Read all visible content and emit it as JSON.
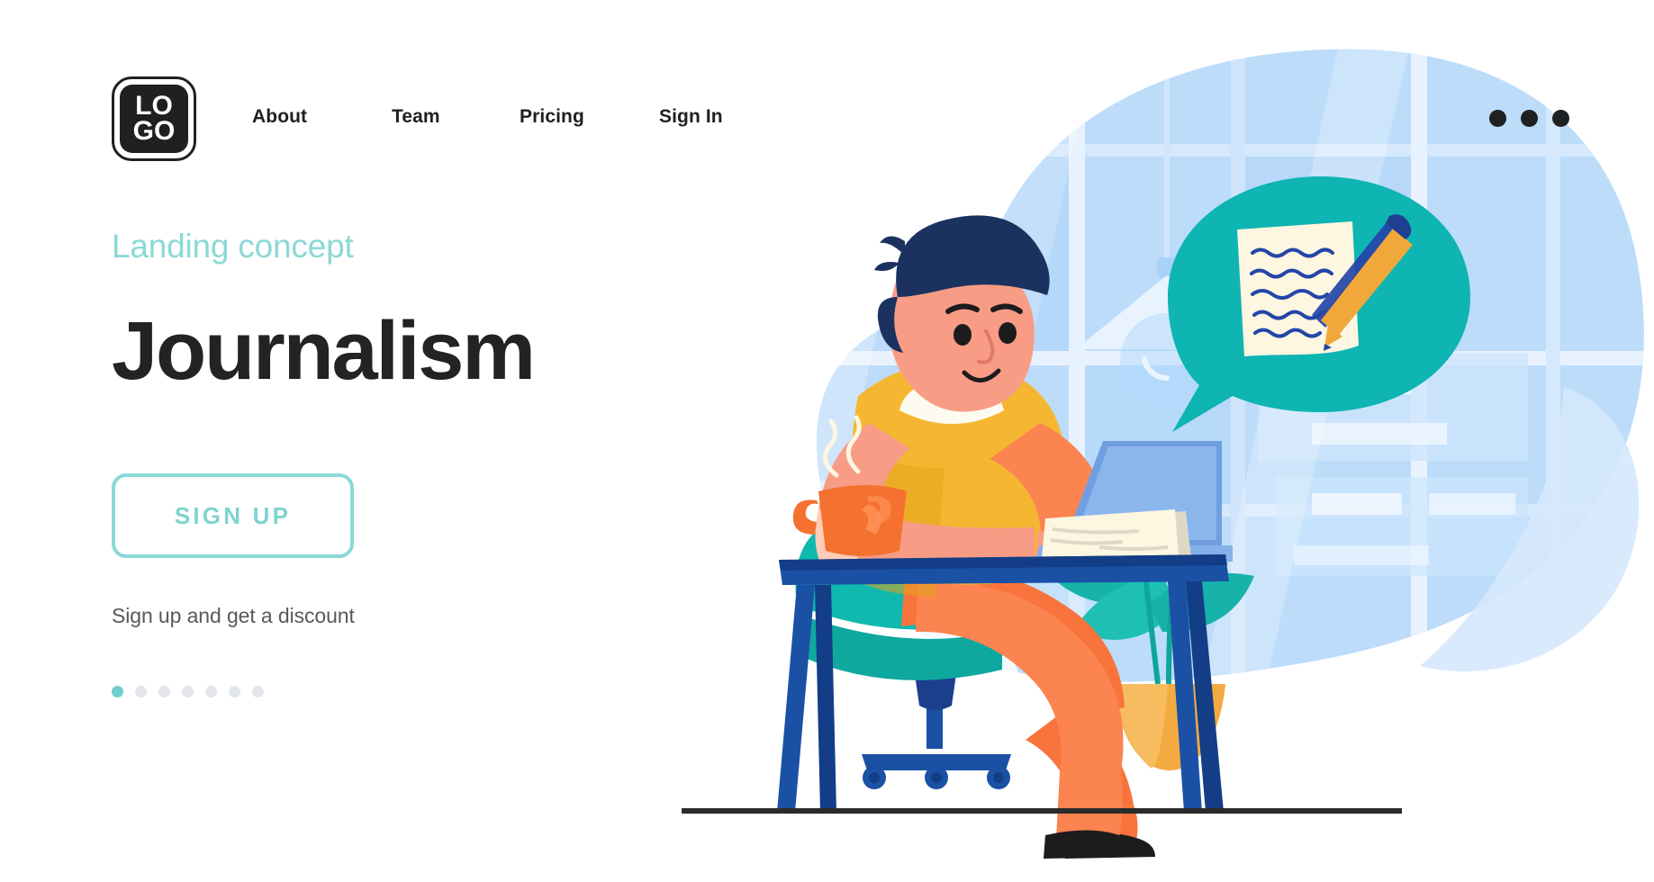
{
  "header": {
    "logo": {
      "line1": "LO",
      "line2": "GO",
      "name": "logo"
    },
    "nav": [
      {
        "label": "About",
        "name": "nav-about"
      },
      {
        "label": "Team",
        "name": "nav-team"
      },
      {
        "label": "Pricing",
        "name": "nav-pricing"
      },
      {
        "label": "Sign In",
        "name": "nav-sign-in"
      }
    ],
    "menu_icon": "kebab-menu-icon"
  },
  "hero": {
    "eyebrow": "Landing concept",
    "headline": "Journalism",
    "cta_label": "SIGN UP",
    "subtext": "Sign up and get a discount",
    "carousel": {
      "total": 7,
      "active_index": 0
    }
  },
  "colors": {
    "accent_teal": "#8ad9d5",
    "cta_text": "#7fd3d0",
    "dot_active": "#6ecfcb",
    "dot_inactive": "#e2e6ea",
    "headline": "#212325",
    "subtext": "#58595b",
    "logo_dark": "#1f2022",
    "blob_blue": "#bcdcfa",
    "bubble_teal": "#0eb5b2",
    "desk_blue": "#1b51a5",
    "desk_dark": "#133d86",
    "shirt_yellow": "#f5b731",
    "pants_orange": "#f8743c",
    "chair_teal": "#0fb9ae",
    "skin": "#f89c86",
    "hair_navy": "#1b3260",
    "plant_teal": "#17b3ab",
    "pot_orange": "#f3ab41",
    "paper_cream": "#fdf6e0",
    "pen_orange": "#f0a83a",
    "mug_orange": "#f4712f"
  },
  "illustration": {
    "name": "journalist-at-desk-illustration",
    "scene_elements": [
      "office-window-background",
      "pendant-lamp",
      "speech-bubble-with-note-and-pen",
      "man-with-beret-typing-on-laptop",
      "coffee-mug-with-steam",
      "office-desk",
      "office-chair",
      "stack-of-papers",
      "potted-plant",
      "floor-line"
    ]
  }
}
